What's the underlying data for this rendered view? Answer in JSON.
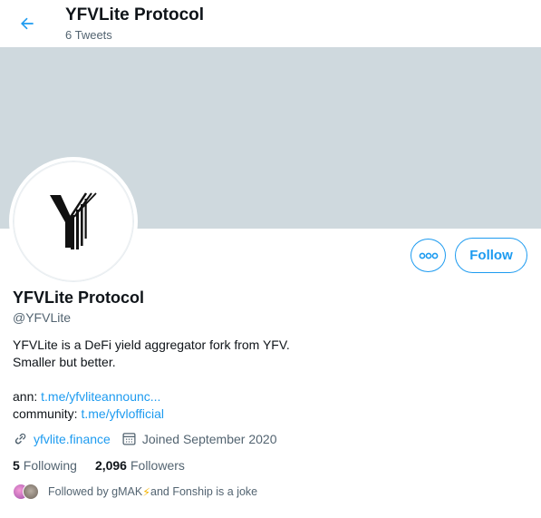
{
  "header": {
    "title": "YFVLite Protocol",
    "subtitle": "6 Tweets"
  },
  "profile": {
    "name": "YFVLite Protocol",
    "handle": "@YFVLite",
    "bio_line1": "YFVLite is a DeFi yield aggregator fork from YFV.",
    "bio_line2": "Smaller but better.",
    "ann_label": "ann: ",
    "ann_link": "t.me/yfvliteannounc...",
    "community_label": "community: ",
    "community_link": "t.me/yfvlofficial",
    "website": "yfvlite.finance",
    "joined": "Joined September 2020"
  },
  "actions": {
    "follow_label": "Follow"
  },
  "stats": {
    "following_count": "5",
    "following_label": "Following",
    "followers_count": "2,096",
    "followers_label": "Followers"
  },
  "followed_by": {
    "prefix": "Followed by gMAK",
    "bolt": "⚡",
    "suffix": " and Fonship is a joke"
  },
  "colors": {
    "accent": "#1d9bf0",
    "banner": "#cfd9de",
    "secondary_text": "#536471"
  },
  "icons": [
    "back-arrow-icon",
    "more-icon",
    "link-icon",
    "calendar-icon",
    "yfv-logo"
  ]
}
